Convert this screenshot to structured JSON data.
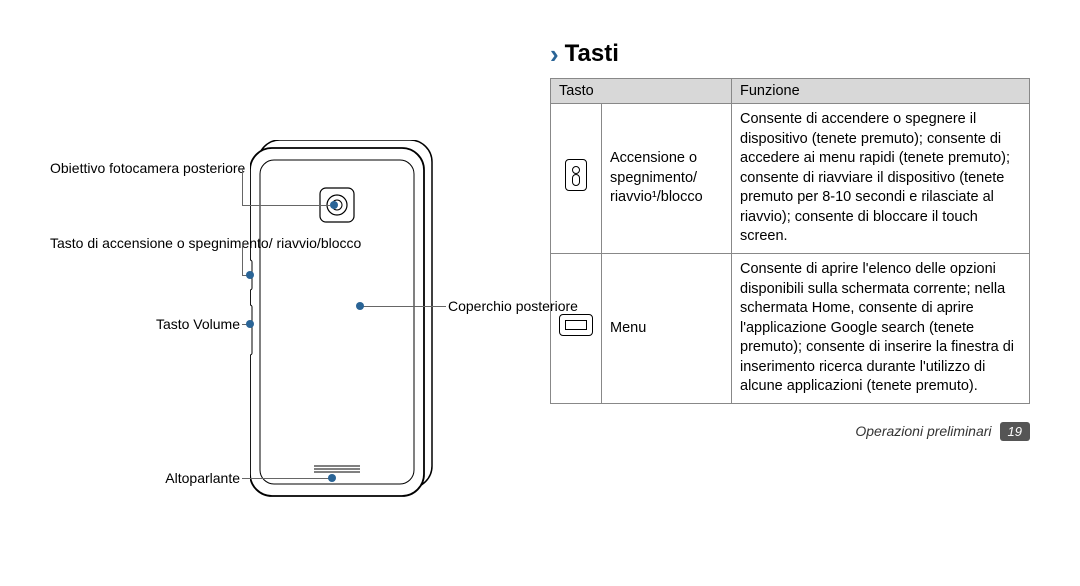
{
  "section_title": "Tasti",
  "table": {
    "header_key": "Tasto",
    "header_func": "Funzione",
    "rows": [
      {
        "name": "Accensione o spegnimento/ riavvio¹/blocco",
        "func": "Consente di accendere o spegnere il dispositivo (tenete premuto); consente di accedere ai menu rapidi (tenete premuto); consente di riavviare il dispositivo (tenete premuto per 8-10 secondi e rilasciate al riavvio); consente di bloccare il touch screen."
      },
      {
        "name": "Menu",
        "func": "Consente di aprire l'elenco delle opzioni disponibili sulla schermata corrente; nella schermata Home, consente di aprire l'applicazione Google search (tenete premuto); consente di inserire la finestra di inserimento ricerca durante l'utilizzo di alcune applicazioni (tenete premuto)."
      }
    ]
  },
  "callouts": {
    "camera": "Obiettivo fotocamera posteriore",
    "power": "Tasto di accensione o spegnimento/ riavvio/blocco",
    "volume": "Tasto Volume",
    "speaker": "Altoparlante",
    "back_cover": "Coperchio posteriore"
  },
  "footer": {
    "label": "Operazioni preliminari",
    "page": "19"
  }
}
